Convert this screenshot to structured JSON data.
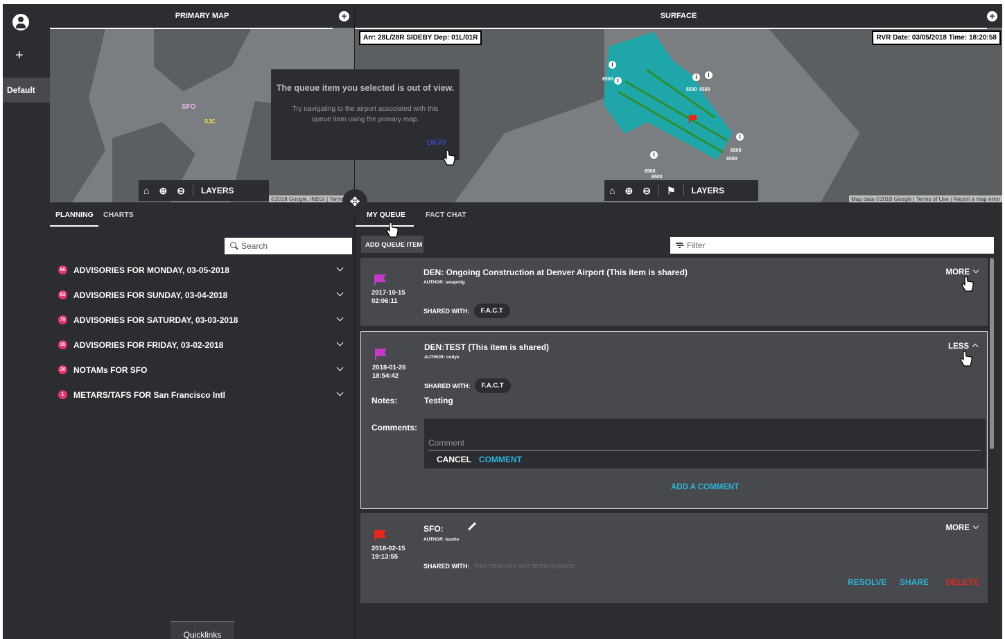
{
  "sidebar": {
    "default_label": "Default",
    "plus_label": "+"
  },
  "primary_map": {
    "title": "PRIMARY MAP",
    "labels": {
      "sfo": "SFO",
      "sjc": "SJC"
    },
    "toolbar_layers": "LAYERS",
    "attribution": "©2018 Google, INEGI  |  Terms of"
  },
  "surface_map": {
    "title": "SURFACE",
    "runway_config": "Arr: 28L/28R SIDEBY Dep: 01L/01R",
    "rvr": "RVR Date: 03/05/2018 Time: 18:20:58",
    "toolbar_layers": "LAYERS",
    "attribution": "Map data ©2018 Google  |  Terms of Use  |  Report a map error",
    "rvr_values": [
      "6500",
      "6500",
      "6500",
      "6500",
      "6500",
      "6500",
      "6500",
      "6500",
      "6500",
      "6500"
    ]
  },
  "dialog": {
    "title": "The queue item you selected is out of view.",
    "body": "Try navigating to the airport associated with this queue item using the primary map.",
    "button": "OKAY"
  },
  "left_tabs": [
    "PLANNING",
    "CHARTS"
  ],
  "search": {
    "placeholder": "Search"
  },
  "advisories": [
    {
      "count": "66",
      "label": "ADVISORIES FOR MONDAY, 03-05-2018"
    },
    {
      "count": "83",
      "label": "ADVISORIES FOR SUNDAY, 03-04-2018"
    },
    {
      "count": "79",
      "label": "ADVISORIES FOR SATURDAY, 03-03-2018"
    },
    {
      "count": "35",
      "label": "ADVISORIES FOR FRIDAY, 03-02-2018"
    },
    {
      "count": "30",
      "label": "NOTAMs FOR SFO"
    },
    {
      "count": "1",
      "label": "METARS/TAFS FOR San Francisco Intl"
    }
  ],
  "quicklinks": "Quicklinks",
  "right_tabs": [
    "MY QUEUE",
    "FACT CHAT"
  ],
  "add_queue_item": "ADD QUEUE ITEM",
  "filter": {
    "placeholder": "Filter"
  },
  "queue": [
    {
      "flag_color": "#c638c8",
      "date": "2017-10-15",
      "time": "02:06:11",
      "title": "DEN: Ongoing Construction at Denver Airport (This item is shared)",
      "author_label": "AUTHOR:",
      "author": "swapnilg",
      "shared_label": "SHARED WITH:",
      "shared_with": "F.A.C.T",
      "toggle": "MORE"
    },
    {
      "flag_color": "#c638c8",
      "date": "2018-01-26",
      "time": "18:54:42",
      "title": "DEN:TEST (This item is shared)",
      "author_label": "AUTHOR:",
      "author": "codye",
      "shared_label": "SHARED WITH:",
      "shared_with": "F.A.C.T",
      "toggle": "LESS",
      "notes_label": "Notes:",
      "notes": "Testing",
      "comments_label": "Comments:",
      "comment_placeholder": "Comment",
      "cancel": "CANCEL",
      "comment_button": "COMMENT",
      "add_comment": "ADD A COMMENT"
    },
    {
      "flag_color": "#e8261c",
      "date": "2018-02-15",
      "time": "19:13:55",
      "title": "SFO:",
      "author_label": "AUTHOR:",
      "author": "ksotto",
      "shared_label": "SHARED WITH:",
      "shared_with": "THIS ITEM HAS NOT BEEN SHARED",
      "toggle": "MORE",
      "resolve": "RESOLVE",
      "share": "SHARE",
      "delete": "DELETE"
    }
  ],
  "colors": {
    "accent": "#2bb4d6",
    "badge": "#e8336b",
    "delete": "#e8261c",
    "dialog_button": "#3f4ce0"
  }
}
